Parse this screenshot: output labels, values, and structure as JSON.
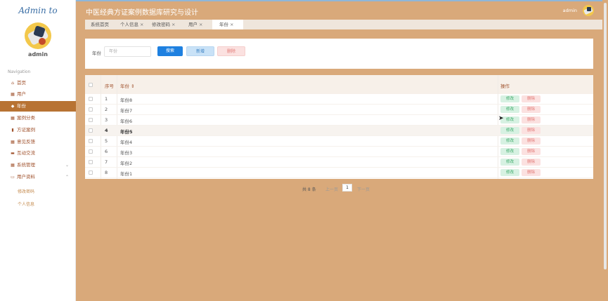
{
  "app": {
    "logo": "Admin to",
    "title": "中医经典方证案例数据库研究与设计",
    "user": "admin"
  },
  "sidebar": {
    "username": "admin",
    "nav_label": "Navigation",
    "items": [
      {
        "label": "首页",
        "icon": "home-icon"
      },
      {
        "label": "用户",
        "icon": "grid-icon"
      },
      {
        "label": "年份",
        "icon": "tag-icon"
      },
      {
        "label": "案例分类",
        "icon": "grid-icon"
      },
      {
        "label": "方证案例",
        "icon": "chart-icon"
      },
      {
        "label": "意见反馈",
        "icon": "grid-icon"
      },
      {
        "label": "互动交流",
        "icon": "briefcase-icon"
      },
      {
        "label": "系统管理",
        "icon": "grid-icon"
      },
      {
        "label": "用户资料",
        "icon": "card-icon"
      }
    ],
    "sub_items": [
      "修改密码",
      "个人信息"
    ]
  },
  "tabs": [
    {
      "label": "系统首页",
      "close": ""
    },
    {
      "label": "个人信息",
      "close": "×"
    },
    {
      "label": "修改密码",
      "close": "×"
    },
    {
      "label": "用户",
      "close": "×"
    },
    {
      "label": "年份",
      "close": "×"
    }
  ],
  "search": {
    "label": "年份",
    "placeholder": "年份",
    "btn_search": "搜索",
    "btn_add": "新增",
    "btn_delete": "删除"
  },
  "table": {
    "headers": {
      "index": "序号",
      "year": "年份 ⇕",
      "actions": "操作"
    },
    "edit_label": "修改",
    "delete_label": "删除",
    "rows": [
      {
        "index": "1",
        "year": "年份8"
      },
      {
        "index": "2",
        "year": "年份7"
      },
      {
        "index": "3",
        "year": "年份6"
      },
      {
        "index": "4",
        "year": "年份5"
      },
      {
        "index": "5",
        "year": "年份4"
      },
      {
        "index": "6",
        "year": "年份3"
      },
      {
        "index": "7",
        "year": "年份2"
      },
      {
        "index": "8",
        "year": "年份1"
      }
    ]
  },
  "pagination": {
    "total": "共 8 条",
    "prev": "上一页",
    "current": "1",
    "next": "下一页"
  }
}
